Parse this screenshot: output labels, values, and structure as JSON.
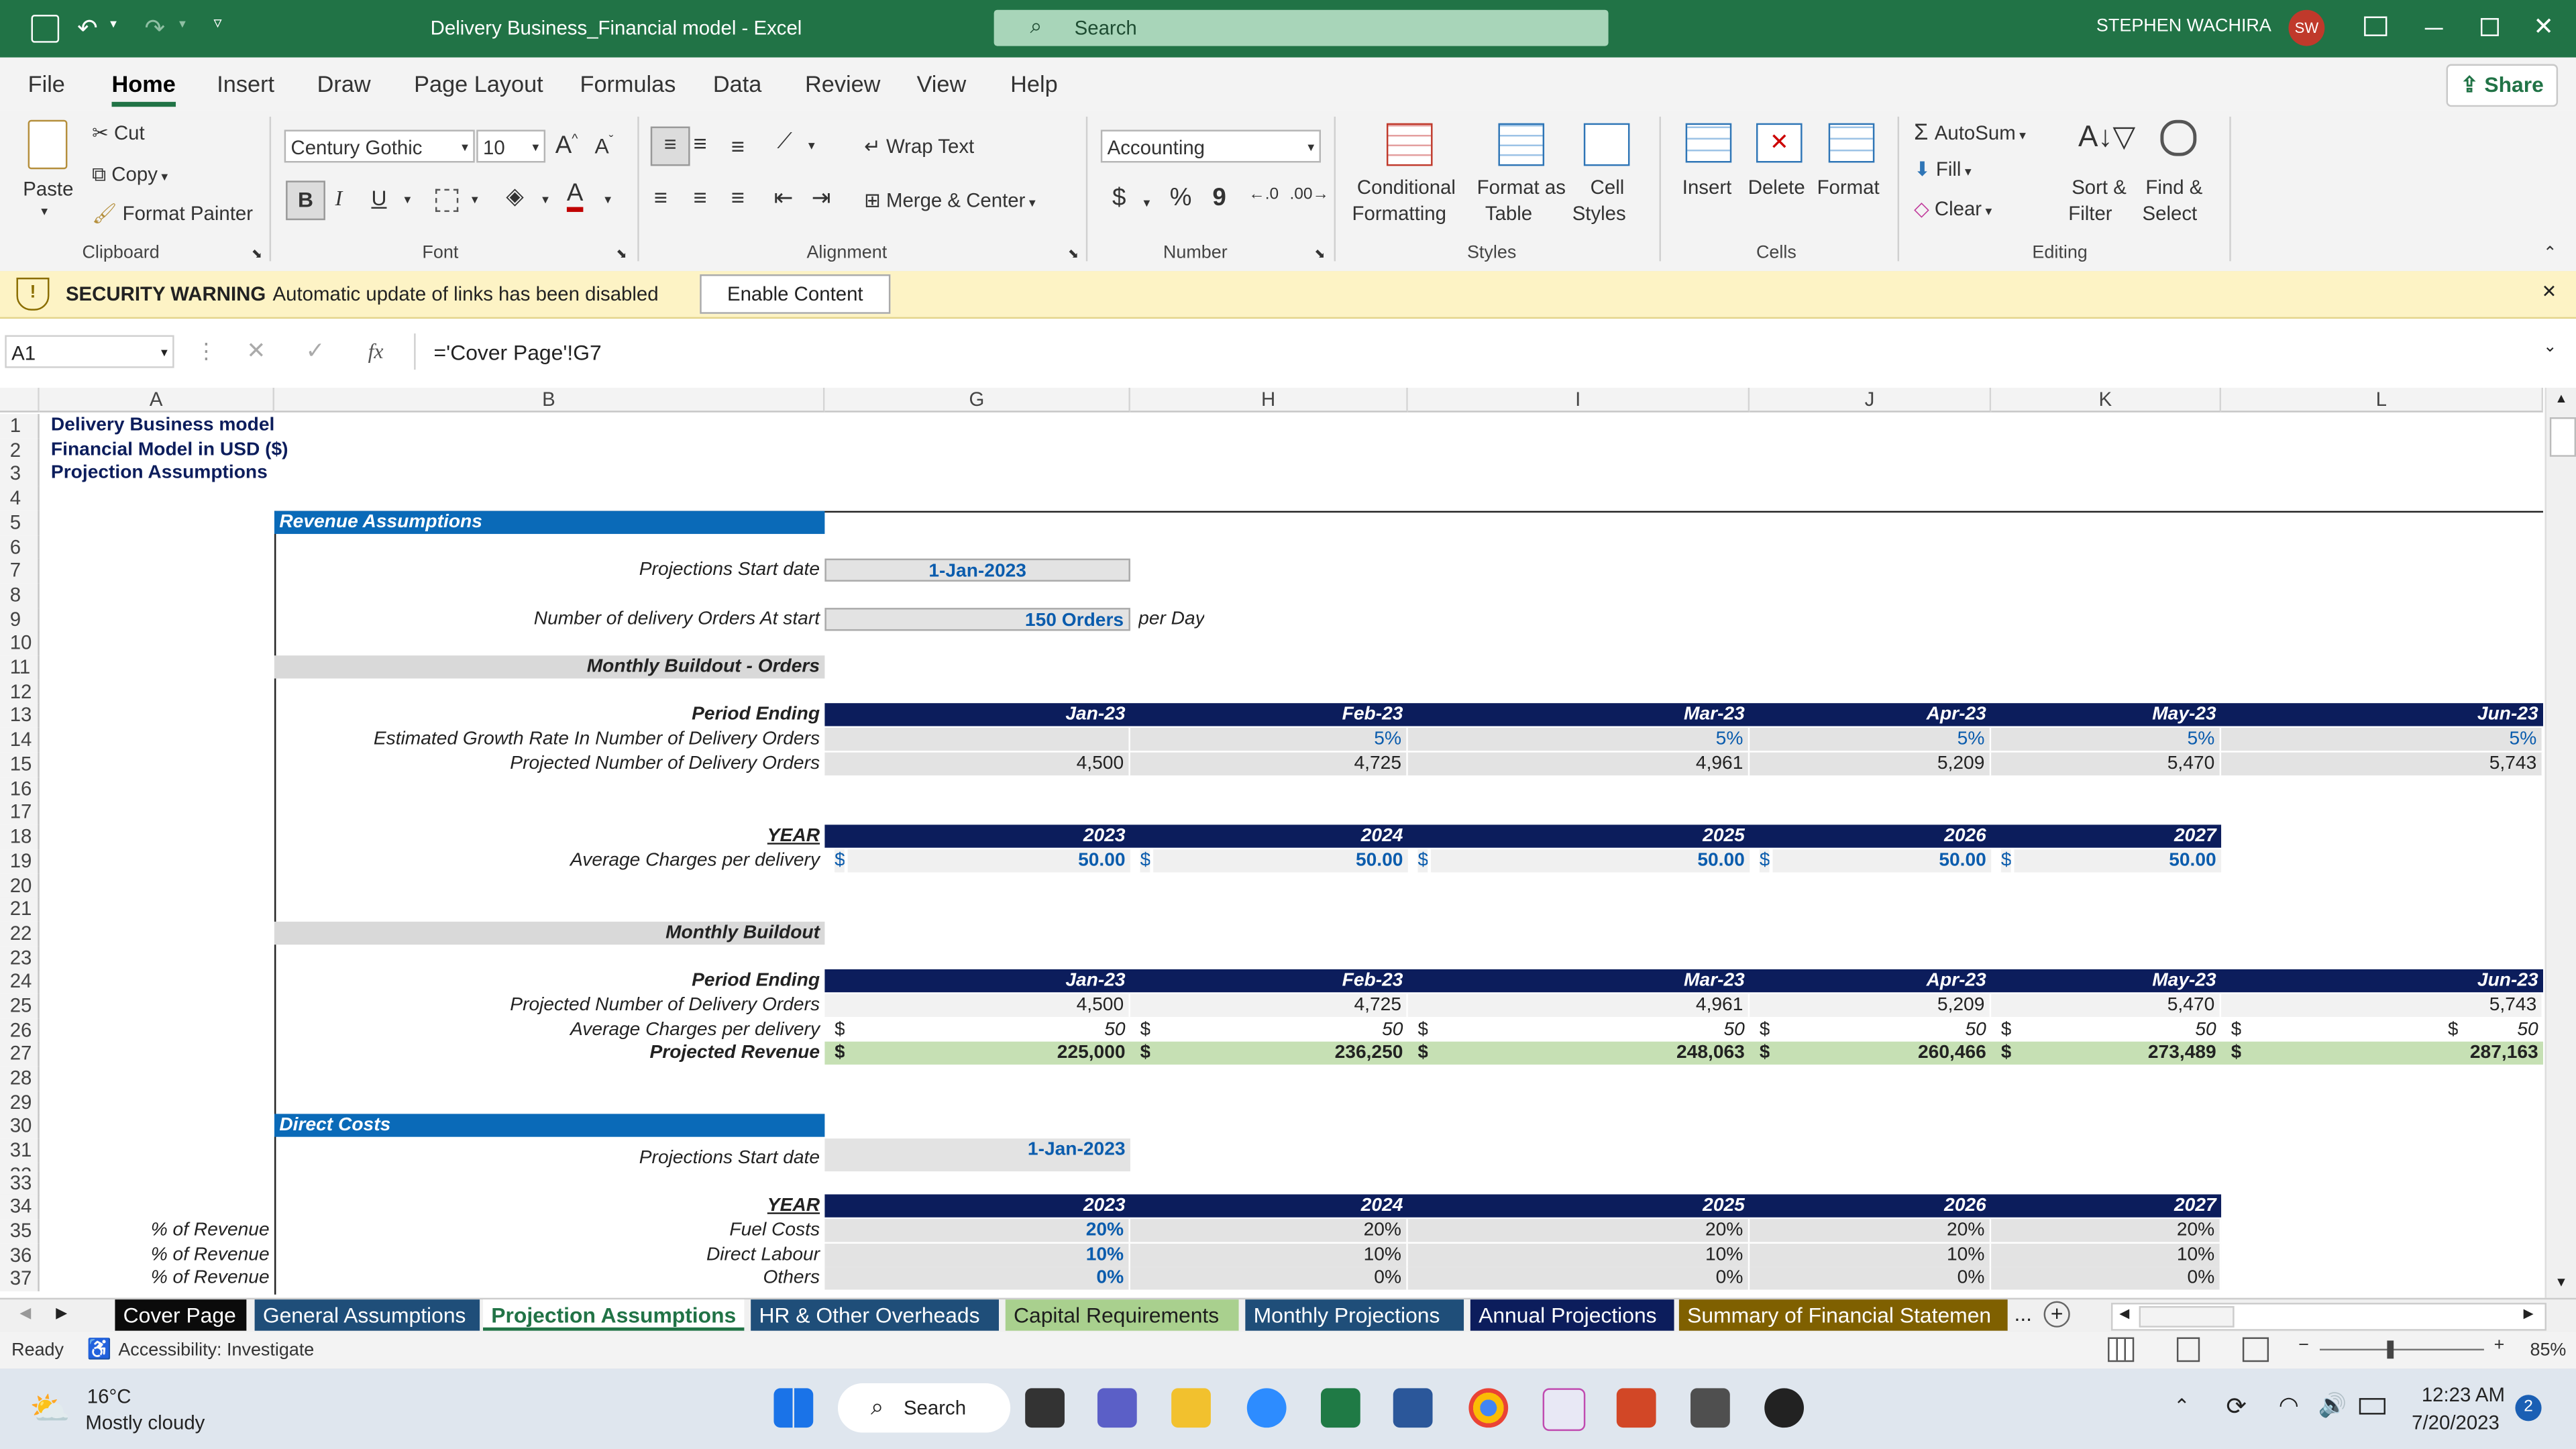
{
  "titlebar": {
    "doc_title": "Delivery Business_Financial model  -  Excel",
    "search_placeholder": "Search",
    "user_name": "STEPHEN WACHIRA",
    "user_initials": "SW"
  },
  "menu": {
    "items": [
      "File",
      "Home",
      "Insert",
      "Draw",
      "Page Layout",
      "Formulas",
      "Data",
      "Review",
      "View",
      "Help"
    ],
    "active": "Home",
    "share_label": "Share"
  },
  "ribbon": {
    "paste": "Paste",
    "cut": "Cut",
    "copy": "Copy",
    "format_painter": "Format Painter",
    "clipboard": "Clipboard",
    "font_name": "Century Gothic",
    "font_size": "10",
    "bold": "B",
    "italic": "I",
    "underline": "U",
    "font_color_letter": "A",
    "font": "Font",
    "wrap_text": "Wrap Text",
    "merge_center": "Merge & Center",
    "alignment": "Alignment",
    "number_format": "Accounting",
    "currency": "$",
    "percent": "%",
    "comma": "9",
    "number": "Number",
    "conditional_formatting": [
      "Conditional",
      "Formatting"
    ],
    "format_as_table": [
      "Format as",
      "Table"
    ],
    "cell_styles": [
      "Cell",
      "Styles"
    ],
    "styles": "Styles",
    "insert": "Insert",
    "delete": "Delete",
    "format": "Format",
    "cells": "Cells",
    "autosum": "AutoSum",
    "fill": "Fill",
    "clear": "Clear",
    "sort_filter": [
      "Sort &",
      "Filter"
    ],
    "find_select": [
      "Find &",
      "Select"
    ],
    "editing": "Editing"
  },
  "security": {
    "title": "SECURITY WARNING",
    "message": "Automatic update of links has been disabled",
    "button": "Enable Content"
  },
  "formula_bar": {
    "name_box": "A1",
    "fx": "fx",
    "formula": "='Cover Page'!G7"
  },
  "columns": [
    "A",
    "B",
    "G",
    "H",
    "I",
    "J",
    "K",
    "L"
  ],
  "rows": [
    "1",
    "2",
    "3",
    "4",
    "5",
    "6",
    "7",
    "8",
    "9",
    "10",
    "11",
    "12",
    "13",
    "14",
    "15",
    "16",
    "17",
    "18",
    "19",
    "20",
    "21",
    "22",
    "23",
    "24",
    "25",
    "26",
    "27",
    "28",
    "29",
    "30",
    "31",
    "32",
    "33",
    "34",
    "35",
    "36",
    "37"
  ],
  "sheet": {
    "title1": "Delivery Business model",
    "title2": "Financial  Model in USD ($)",
    "title3": "Projection Assumptions",
    "revenue_assumptions": "Revenue Assumptions",
    "proj_start_label": "Projections  Start date",
    "proj_start_value": "1-Jan-2023",
    "orders_label": "Number of delivery Orders At start",
    "orders_value": "150 Orders",
    "orders_unit": "per Day",
    "monthly_buildout_orders": "Monthly Buildout - Orders",
    "period_ending": "Period Ending",
    "months": [
      "Jan-23",
      "Feb-23",
      "Mar-23",
      "Apr-23",
      "May-23",
      "Jun-23"
    ],
    "growth_label": "Estimated Growth Rate In Number of  Delivery Orders",
    "growth": [
      "",
      "5%",
      "5%",
      "5%",
      "5%",
      "5%"
    ],
    "proj_orders_label": "Projected Number of Delivery Orders",
    "proj_orders": [
      "4,500",
      "4,725",
      "4,961",
      "5,209",
      "5,470",
      "5,743"
    ],
    "year_label": "YEAR",
    "years": [
      "2023",
      "2024",
      "2025",
      "2026",
      "2027"
    ],
    "avg_charges_label": "Average Charges per delivery",
    "avg_charges_year": [
      "50.00",
      "50.00",
      "50.00",
      "50.00",
      "50.00"
    ],
    "currency_symbol": "$",
    "monthly_buildout": "Monthly Buildout",
    "avg_charges_month": [
      "50",
      "50",
      "50",
      "50",
      "50",
      "50"
    ],
    "proj_revenue_label": "Projected Revenue",
    "proj_revenue": [
      "225,000",
      "236,250",
      "248,063",
      "260,466",
      "273,489",
      "287,163"
    ],
    "direct_costs": "Direct Costs",
    "pct_of_revenue": "% of Revenue",
    "fuel_costs_label": "Fuel Costs",
    "fuel_costs": [
      "20%",
      "20%",
      "20%",
      "20%",
      "20%"
    ],
    "direct_labour_label": "Direct Labour",
    "direct_labour": [
      "10%",
      "10%",
      "10%",
      "10%",
      "10%"
    ],
    "others_label": "Others",
    "others": [
      "0%",
      "0%",
      "0%",
      "0%",
      "0%"
    ]
  },
  "tabs": [
    {
      "label": "Cover Page",
      "bg": "#0b0b0b",
      "fg": "#ffffff"
    },
    {
      "label": "General Assumptions",
      "bg": "#1f4e79",
      "fg": "#ffffff"
    },
    {
      "label": "Projection Assumptions",
      "bg": "#ffffff",
      "fg": "#217346"
    },
    {
      "label": "HR & Other Overheads",
      "bg": "#1f4e79",
      "fg": "#ffffff"
    },
    {
      "label": "Capital Requirements",
      "bg": "#a9d08e",
      "fg": "#1d1d1d"
    },
    {
      "label": "Monthly Projections",
      "bg": "#1f4e79",
      "fg": "#ffffff"
    },
    {
      "label": "Annual Projections",
      "bg": "#0c1d5c",
      "fg": "#ffffff"
    },
    {
      "label": "Summary of Financial Statemen",
      "bg": "#7f6000",
      "fg": "#ffffff"
    }
  ],
  "tabs_more": "...",
  "status": {
    "ready": "Ready",
    "accessibility": "Accessibility: Investigate",
    "zoom": "85%"
  },
  "taskbar": {
    "temp": "16°C",
    "weather": "Mostly cloudy",
    "search": "Search",
    "time": "12:23 AM",
    "date": "7/20/2023",
    "notif": "2"
  },
  "colors": {
    "excel_green": "#217346",
    "navy": "#0c1d5c",
    "section_blue": "#0a6ab8",
    "input_blue": "#0b5cad",
    "revenue_green": "#c6e0b4",
    "security_yellow": "#fdf3c5"
  }
}
